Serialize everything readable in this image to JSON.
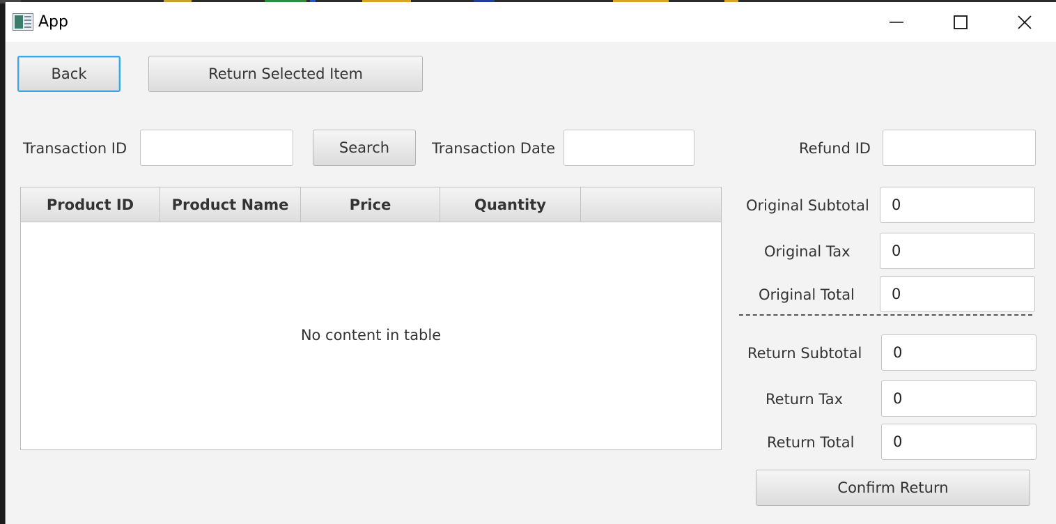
{
  "window": {
    "title": "App"
  },
  "toolbar": {
    "back_label": "Back",
    "return_selected_label": "Return Selected Item"
  },
  "search": {
    "transaction_id_label": "Transaction ID",
    "transaction_id_value": "",
    "search_label": "Search",
    "transaction_date_label": "Transaction Date",
    "transaction_date_value": "",
    "refund_id_label": "Refund ID",
    "refund_id_value": ""
  },
  "table": {
    "columns": [
      "Product ID",
      "Product Name",
      "Price",
      "Quantity",
      ""
    ],
    "rows": [],
    "empty_message": "No content in table"
  },
  "summary": {
    "original_subtotal_label": "Original Subtotal",
    "original_subtotal_value": "0",
    "original_tax_label": "Original Tax",
    "original_tax_value": "0",
    "original_total_label": "Original Total",
    "original_total_value": "0",
    "return_subtotal_label": "Return Subtotal",
    "return_subtotal_value": "0",
    "return_tax_label": "Return Tax",
    "return_tax_value": "0",
    "return_total_label": "Return Total",
    "return_total_value": "0"
  },
  "actions": {
    "confirm_return_label": "Confirm Return"
  },
  "colors": {
    "focus_accent": "#3aa6e3",
    "window_bg": "#f3f3f3",
    "titlebar_bg": "#ffffff"
  },
  "icons": {
    "app": "app-window-icon",
    "minimize": "minimize-icon",
    "maximize": "maximize-icon",
    "close": "close-icon"
  }
}
